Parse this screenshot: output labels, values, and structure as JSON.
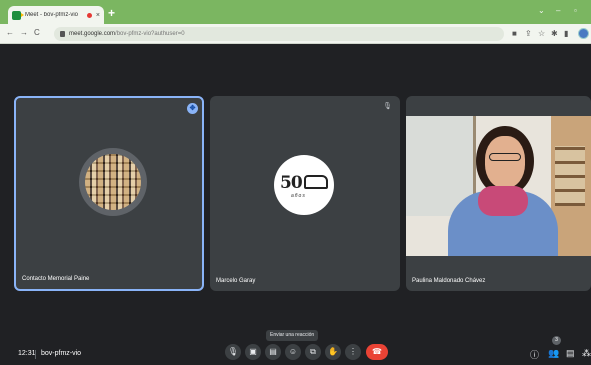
{
  "browser": {
    "tab_title": "Meet - bov-pfmz-vio",
    "tab_close": "×",
    "new_tab": "+",
    "url_host": "meet.google.com",
    "url_path": "/bov-pfmz-vio?authuser=0",
    "window_controls": [
      "⌄",
      "–",
      "▫"
    ]
  },
  "tiles": [
    {
      "name": "Contacto Memorial Paine",
      "kind": "avatar-collage",
      "pinned": true
    },
    {
      "name": "Marcelo Garay",
      "kind": "logo",
      "logo_text": "50",
      "logo_sub": "años",
      "muted": true
    },
    {
      "name": "Paulina Maldonado Chávez",
      "kind": "video"
    }
  ],
  "controls": {
    "time": "12:31",
    "meeting_code": "bov-pfmz-vio",
    "tooltip": "Enviar una reacción",
    "participants_count": "3",
    "buttons": [
      {
        "icon": "mic-icon",
        "glyph": "🎙"
      },
      {
        "icon": "camera-icon",
        "glyph": "▣"
      },
      {
        "icon": "captions-icon",
        "glyph": "▤"
      },
      {
        "icon": "emoji-icon",
        "glyph": "☺"
      },
      {
        "icon": "present-icon",
        "glyph": "⧉"
      },
      {
        "icon": "raise-hand-icon",
        "glyph": "✋"
      },
      {
        "icon": "more-options-icon",
        "glyph": "⋮"
      },
      {
        "icon": "end-call-icon",
        "glyph": "☎"
      }
    ]
  },
  "colors": {
    "chrome_frame": "#7bb661",
    "meet_bg": "#202124",
    "tile_bg": "#3c4043",
    "active_border": "#8ab4f8",
    "end_call": "#ea4335"
  }
}
